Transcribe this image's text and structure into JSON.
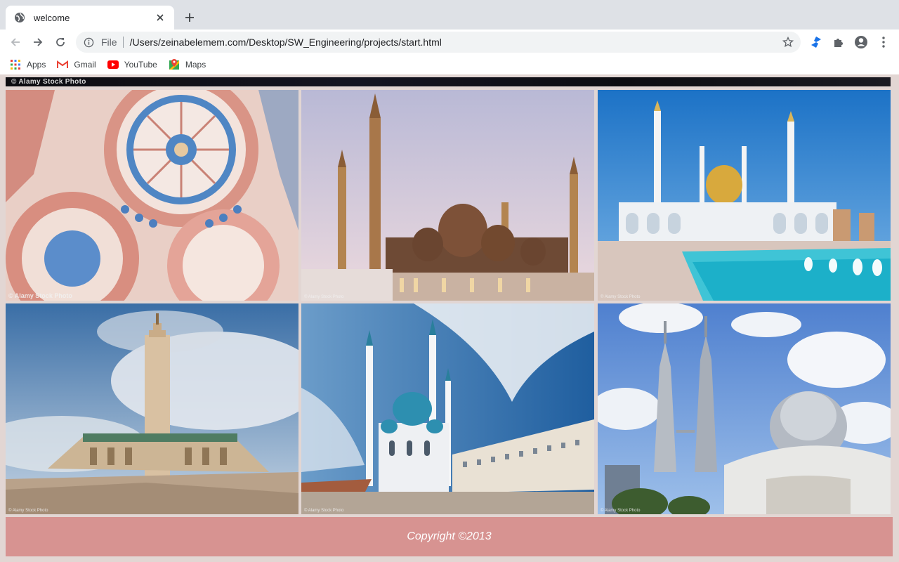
{
  "browser": {
    "tab": {
      "title": "welcome",
      "favicon": "globe-icon"
    },
    "address": {
      "scheme": "File",
      "url": "/Users/zeinabelemem.com/Desktop/SW_Engineering/projects/start.html"
    },
    "bookmarks": [
      {
        "label": "Apps",
        "icon": "apps-grid-icon"
      },
      {
        "label": "Gmail",
        "icon": "gmail-icon"
      },
      {
        "label": "YouTube",
        "icon": "youtube-icon"
      },
      {
        "label": "Maps",
        "icon": "maps-icon"
      }
    ],
    "colors": {
      "tabstrip": "#dee1e6",
      "omnibox": "#f1f3f4",
      "accent_extension": "#1a73e8"
    }
  },
  "page": {
    "hero_credit": "© Alamy Stock Photo",
    "gallery": [
      {
        "name": "ornate-dome-interior",
        "credit": "© Alamy Stock Photo"
      },
      {
        "name": "golden-domed-mosque-dusk",
        "credit": "© Alamy Stock Photo"
      },
      {
        "name": "white-mosque-gold-dome-fountain",
        "credit": "© Alamy Stock Photo"
      },
      {
        "name": "minaret-mosque-cloudy-sky",
        "credit": "© Alamy Stock Photo"
      },
      {
        "name": "blue-domed-mosque-courtyard",
        "credit": "© Alamy Stock Photo"
      },
      {
        "name": "twin-towers-silver-dome",
        "credit": "© Alamy Stock Photo"
      }
    ],
    "footer": {
      "text": "Copyright ©2013"
    },
    "colors": {
      "background": "#e2d6d3",
      "footer": "#d79391",
      "footer_text": "#ffffff"
    }
  }
}
